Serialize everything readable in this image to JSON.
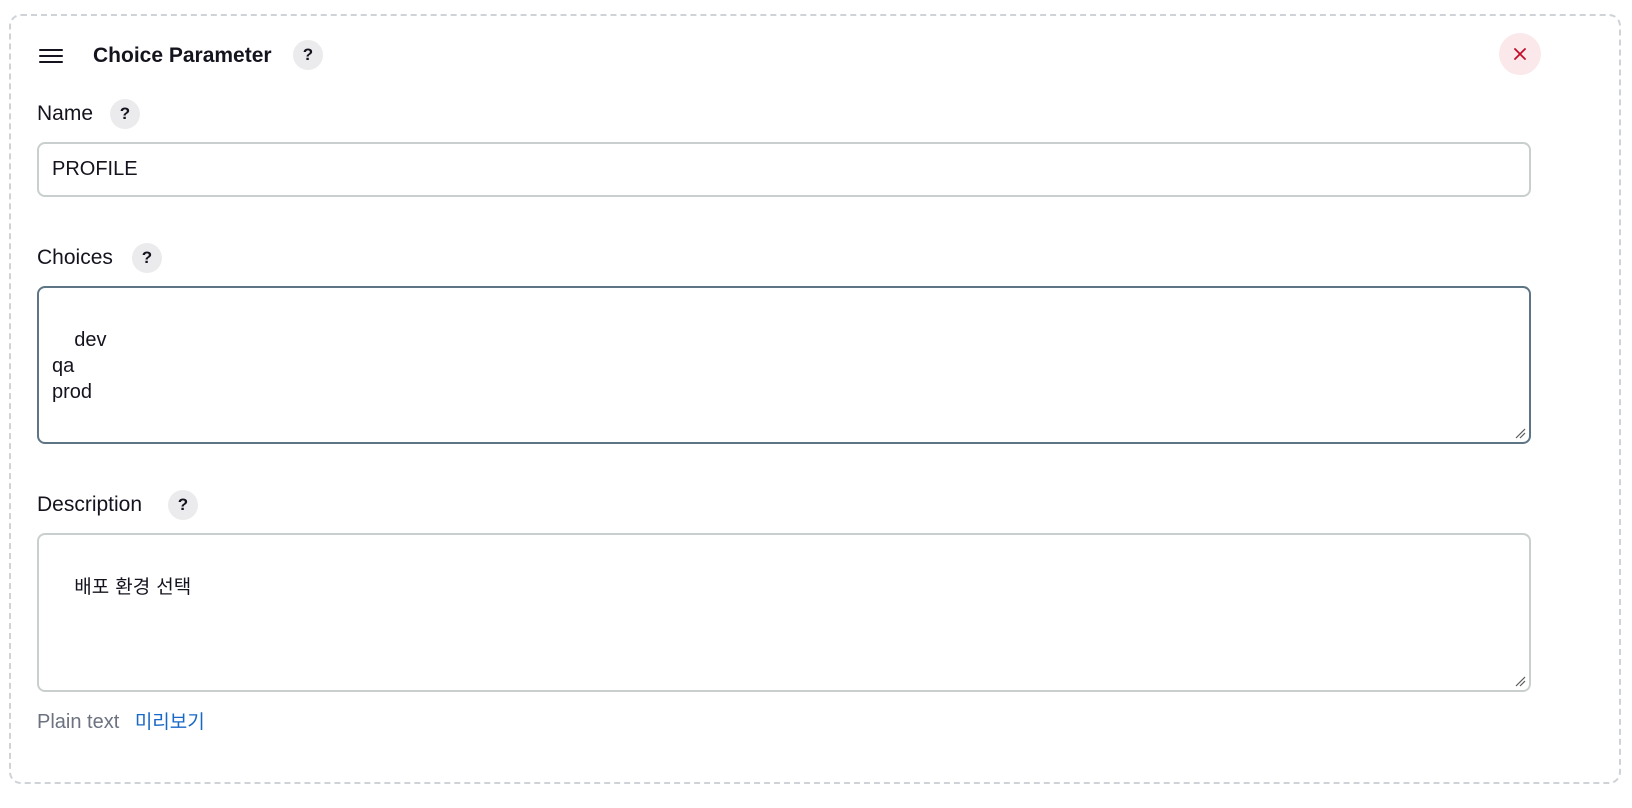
{
  "header": {
    "title": "Choice Parameter",
    "help_glyph": "?",
    "menu_icon": "hamburger-icon",
    "close_icon": "close-icon",
    "close_color": "#c40d2b"
  },
  "name_field": {
    "label": "Name",
    "help_glyph": "?",
    "value": "PROFILE"
  },
  "choices_field": {
    "label": "Choices",
    "help_glyph": "?",
    "value": "dev\nqa\nprod",
    "focus_color": "#5d7585"
  },
  "description_field": {
    "label": "Description",
    "help_glyph": "?",
    "value": "배포 환경 선택"
  },
  "footer": {
    "format_label": "Plain text",
    "preview_link": "미리보기",
    "link_color": "#1869c7"
  }
}
